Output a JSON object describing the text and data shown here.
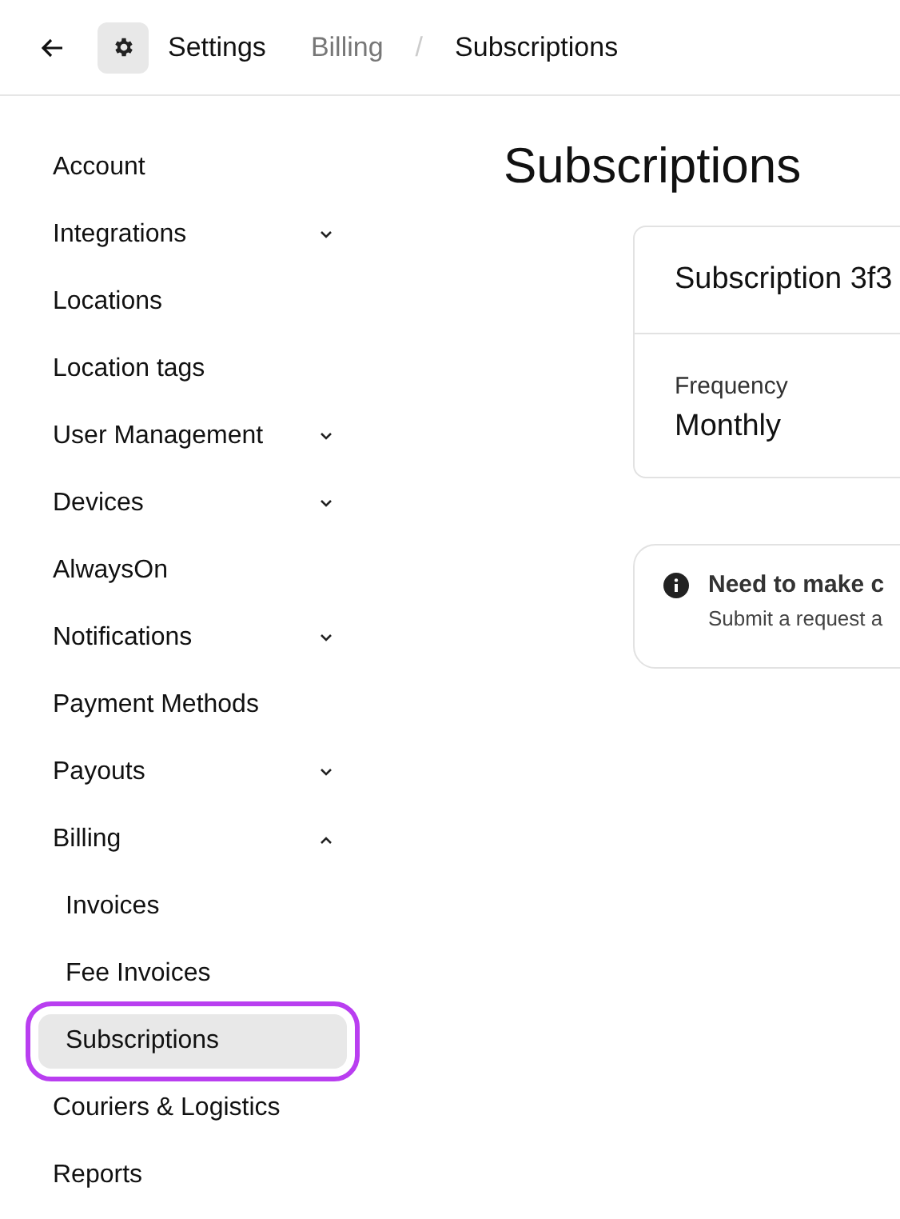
{
  "header": {
    "title": "Settings",
    "separator": "/",
    "breadcrumbs": [
      {
        "label": "Billing",
        "current": false
      },
      {
        "label": "Subscriptions",
        "current": true
      }
    ]
  },
  "sidebar": {
    "items": [
      {
        "label": "Account",
        "selected": false
      },
      {
        "label": "Integrations",
        "selected": false,
        "expanded": false
      },
      {
        "label": "Locations",
        "selected": false
      },
      {
        "label": "Location tags",
        "selected": false
      },
      {
        "label": "User Management",
        "selected": false,
        "expanded": false
      },
      {
        "label": "Devices",
        "selected": false,
        "expanded": false
      },
      {
        "label": "AlwaysOn",
        "selected": false
      },
      {
        "label": "Notifications",
        "selected": false,
        "expanded": false
      },
      {
        "label": "Payment Methods",
        "selected": false
      },
      {
        "label": "Payouts",
        "selected": false,
        "expanded": false
      },
      {
        "label": "Billing",
        "selected": false,
        "expanded": true,
        "children": [
          {
            "label": "Invoices",
            "selected": false
          },
          {
            "label": "Fee Invoices",
            "selected": false
          },
          {
            "label": "Subscriptions",
            "selected": true
          }
        ]
      },
      {
        "label": "Couriers & Logistics",
        "selected": false
      },
      {
        "label": "Reports",
        "selected": false
      }
    ]
  },
  "main": {
    "title": "Subscriptions",
    "subscription": {
      "name": "Subscription 3f3",
      "field_label": "Frequency",
      "field_value": "Monthly"
    },
    "notice": {
      "title": "Need to make c",
      "text": "Submit a request a"
    }
  }
}
